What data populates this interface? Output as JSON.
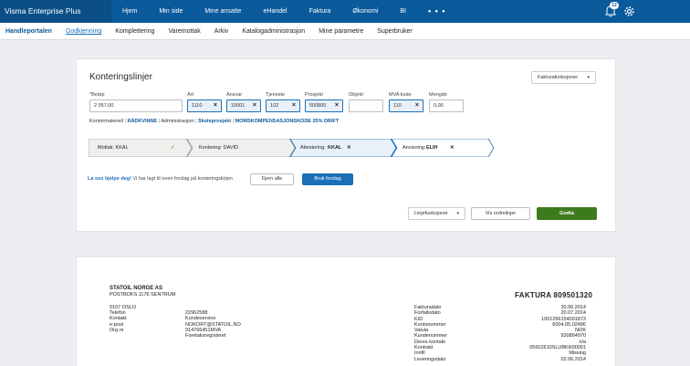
{
  "topbar": {
    "brand": "Visma  Enterprise Plus",
    "nav": [
      "Hjem",
      "Min side",
      "Mine ansatte",
      "eHandel",
      "Faktura",
      "Økonomi",
      "BI",
      "• • •"
    ],
    "notification_count": "12"
  },
  "subnav": {
    "brand": "Handleportalen",
    "items": [
      "Godkjenning",
      "Komplettering",
      "Varemottak",
      "Arkiv",
      "Katalogadministrasjon",
      "Mine parametre",
      "Superbruker"
    ]
  },
  "konteringslinjer": {
    "title": "Konteringslinjer",
    "fakturafunksjoner": "Fakturafunksjoner",
    "fields": [
      {
        "label": "Beløp",
        "required": true,
        "value": "2 057,00",
        "filled": false
      },
      {
        "label": "Art",
        "value": "1110",
        "filled": true
      },
      {
        "label": "Ansvar",
        "value": "10001",
        "filled": true
      },
      {
        "label": "Tjeneste",
        "value": "102",
        "filled": true
      },
      {
        "label": "Prosjekt",
        "value": "500800",
        "filled": true
      },
      {
        "label": "Objekt",
        "value": "",
        "filled": false
      },
      {
        "label": "MVA kode",
        "value": "110",
        "filled": true
      },
      {
        "label": "Mengde",
        "value": "0,00",
        "filled": false
      }
    ],
    "crumbs": {
      "prefix": "Kontormateriell",
      "item1": "RÅDKVINNE",
      "item2_prefix": "Administrasjon",
      "item2": "Skoleprosjekt",
      "item3": "MOMSKOMPENSASJONSKODE 25% DRIFT"
    },
    "flow": [
      {
        "label": "Mottak: KKAL",
        "mark": "✓"
      },
      {
        "label": "Kontering: DAVID",
        "mark": ""
      },
      {
        "label": "Attestering:",
        "name": "KKAL",
        "mark": "✕"
      },
      {
        "label": "Anvisning:",
        "name": "ELIH",
        "mark": "✕"
      }
    ],
    "help_bold": "La oss hjelpe deg!",
    "help_text": " Vi har lagt til noen forslag på konteringslinjen",
    "fjern_alle": "Fjern alle",
    "bruk_forslag": "Bruk forslag",
    "linjefunksjoner": "Linjefunksjoner",
    "vis_ordrelinjer": "Vis ordrelinjer",
    "godta": "Godta"
  },
  "invoice": {
    "company": "STATOIL NORGE AS",
    "address1": "POSTBOKS 1176 SENTRUM",
    "address2": "0107 OSLO",
    "title": "FAKTURA 809501320",
    "left_labels": [
      "Telefon",
      "Kontakt",
      "e-post",
      "Org.nr"
    ],
    "left_values": [
      "22962588",
      "Kundeservice",
      "NOKORT@STATOIL.NO",
      "914766451MVA",
      "Foretaksregisteret"
    ],
    "right_labels": [
      "Fakturadato",
      "Forfallsdato",
      "KID",
      "Kontonummer",
      "Valuta",
      "Kundenummer",
      "Deres kontakt",
      "Kontrakt",
      "Innfil",
      "Leveringsdato"
    ],
    "right_values": [
      "30.06.2014",
      "20.07.2014",
      "1001266154001873",
      "6004.05.02486",
      "NOK",
      "930864970",
      "n/a",
      "05602610SLUBKR00001",
      "Missing",
      "02.06.2014"
    ]
  },
  "colors": {
    "topbar": "#0a5a9c",
    "accent": "#1b6fb8",
    "approve": "#3e7b1f"
  }
}
